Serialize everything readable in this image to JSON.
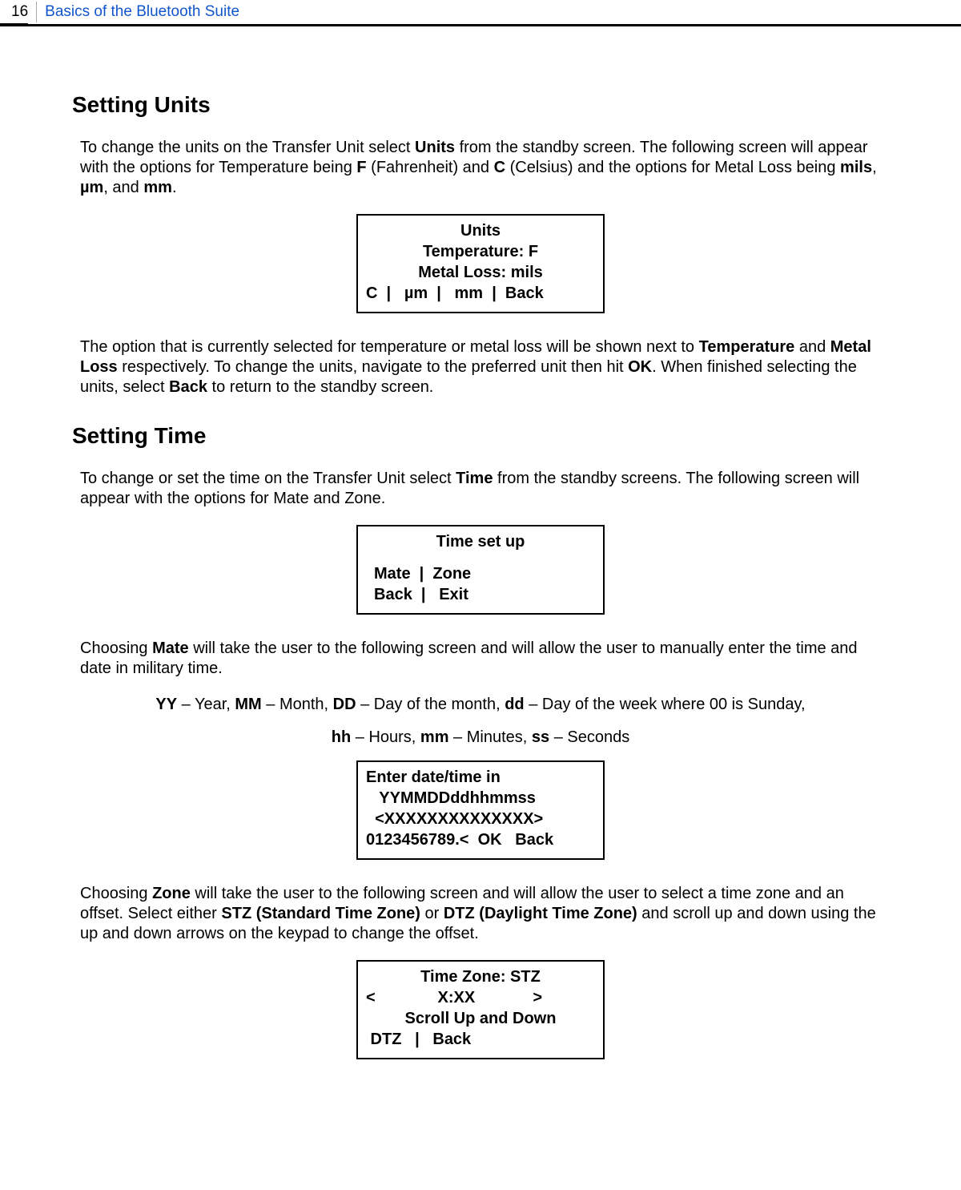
{
  "header": {
    "page_number": "16",
    "section": "Basics of the Bluetooth Suite"
  },
  "setting_units": {
    "heading": "Setting Units",
    "para1_pre": "To change the units on the Transfer Unit select ",
    "para1_b1": "Units",
    "para1_mid1": " from the standby screen. The following screen will appear with the options for Temperature being ",
    "para1_b2": "F",
    "para1_mid2": " (Fahrenheit) and ",
    "para1_b3": "C",
    "para1_mid3": " (Celsius) and the options for Metal Loss being ",
    "para1_b4": "mils",
    "para1_mid4": ", ",
    "para1_b5": "µm",
    "para1_mid5": ", and ",
    "para1_b6": "mm",
    "para1_end": ".",
    "box": {
      "l1": "Units",
      "l2": "Temperature: F",
      "l3": "Metal Loss: mils",
      "l4": "C  |   µm  |   mm  |  Back"
    },
    "para2_pre": "The option that is currently selected for temperature or metal loss will be shown next to ",
    "para2_b1": "Temperature",
    "para2_mid1": " and ",
    "para2_b2": "Metal Loss",
    "para2_mid2": " respectively. To change the units, navigate to the preferred unit then hit ",
    "para2_b3": "OK",
    "para2_mid3": ". When finished selecting the units, select ",
    "para2_b4": "Back",
    "para2_end": " to return to the standby screen."
  },
  "setting_time": {
    "heading": "Setting Time",
    "para1_pre": "To change or set the time on the Transfer Unit select ",
    "para1_b1": "Time",
    "para1_end": " from the standby screens. The following screen will appear with the options for Mate and Zone.",
    "box1": {
      "l1": "Time set up",
      "l2": "Mate  |  Zone",
      "l3": "Back  |   Exit"
    },
    "para2_pre": "Choosing ",
    "para2_b1": "Mate",
    "para2_end": " will take the user to the following screen and will allow the user to manually enter the time and date in military time.",
    "legend_b1": "YY",
    "legend_t1": " – Year, ",
    "legend_b2": "MM",
    "legend_t2": " – Month, ",
    "legend_b3": "DD",
    "legend_t3": " – Day of the month, ",
    "legend_b4": "dd",
    "legend_t4": " – Day of the week where 00 is Sunday,",
    "legend2_b1": "hh",
    "legend2_t1": " – Hours, ",
    "legend2_b2": "mm",
    "legend2_t2": " – Minutes, ",
    "legend2_b3": "ss",
    "legend2_t3": " – Seconds",
    "box2": {
      "l1": "Enter date/time in",
      "l2": "   YYMMDDddhhmmss",
      "l3": "  <XXXXXXXXXXXXXX>",
      "l4": "0123456789.<  OK   Back"
    },
    "para3_pre": "Choosing ",
    "para3_b1": "Zone",
    "para3_mid1": " will take the user to the following screen and will allow the user to select a time zone and an offset. Select either ",
    "para3_b2": "STZ (Standard Time Zone)",
    "para3_mid2": " or ",
    "para3_b3": "DTZ (Daylight Time Zone)",
    "para3_end": " and scroll up and down using the up and down arrows on the keypad to change the offset.",
    "box3": {
      "l1": "Time Zone: STZ",
      "l2": "<              X:XX             >",
      "l3": "Scroll Up and Down",
      "l4": " DTZ   |   Back"
    }
  }
}
